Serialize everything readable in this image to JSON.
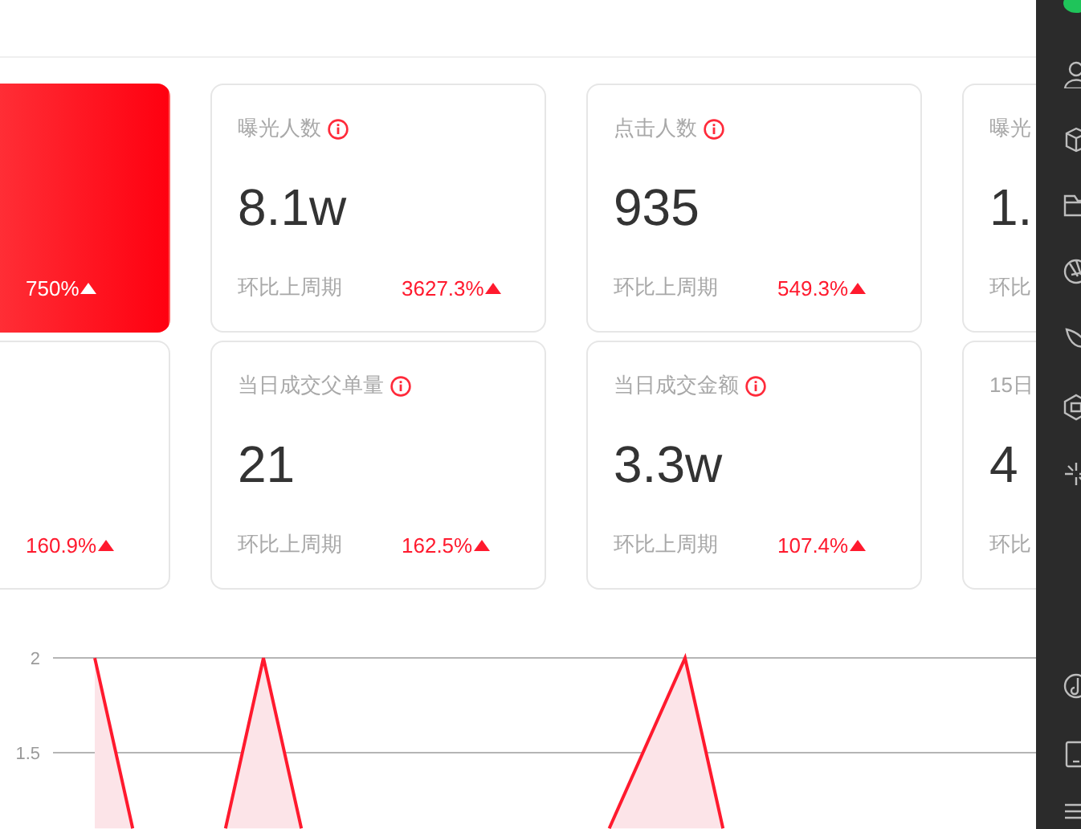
{
  "card_rows": [
    [
      {
        "kind": "highlight",
        "change": "750%"
      },
      {
        "kind": "normal",
        "title": "曝光人数",
        "info": true,
        "value": "8.1w",
        "compare_label": "环比上周期",
        "change": "3627.3%"
      },
      {
        "kind": "normal",
        "title": "点击人数",
        "info": true,
        "value": "935",
        "compare_label": "环比上周期",
        "change": "549.3%"
      },
      {
        "kind": "normal",
        "title": "曝光",
        "value": "1.",
        "compare_label": "环比"
      }
    ],
    [
      {
        "kind": "normal",
        "change": "160.9%"
      },
      {
        "kind": "normal",
        "title": "当日成交父单量",
        "info": true,
        "value": "21",
        "compare_label": "环比上周期",
        "change": "162.5%"
      },
      {
        "kind": "normal",
        "title": "当日成交金额",
        "info": true,
        "value": "3.3w",
        "compare_label": "环比上周期",
        "change": "107.4%"
      },
      {
        "kind": "normal",
        "title": "15日",
        "value": "4",
        "compare_label": "环比"
      }
    ]
  ],
  "chart": {
    "y_axis_labels": [
      "2",
      "1.5"
    ]
  }
}
